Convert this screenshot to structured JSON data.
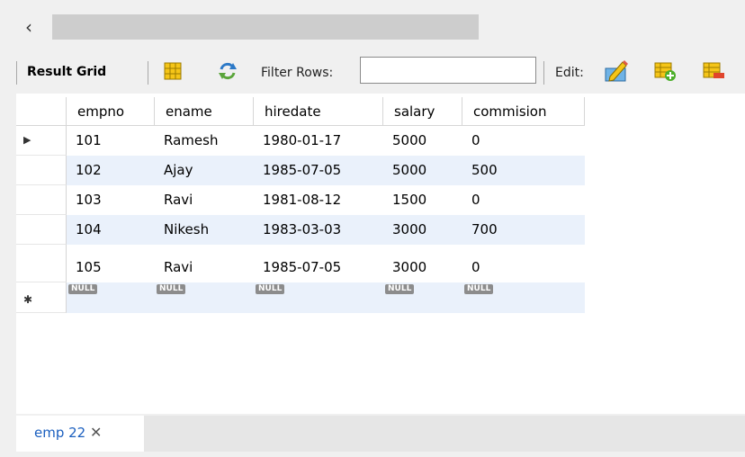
{
  "scroll": {
    "left_arrow": "‹"
  },
  "toolbar": {
    "result_grid": "Result Grid",
    "filter_label": "Filter Rows:",
    "filter_value": "",
    "edit_label": "Edit:"
  },
  "grid": {
    "columns": [
      "empno",
      "ename",
      "hiredate",
      "salary",
      "commision"
    ],
    "rows": [
      [
        "101",
        "Ramesh",
        "1980-01-17",
        "5000",
        "0"
      ],
      [
        "102",
        "Ajay",
        "1985-07-05",
        "5000",
        "500"
      ],
      [
        "103",
        "Ravi",
        "1981-08-12",
        "1500",
        "0"
      ],
      [
        "104",
        "Nikesh",
        "1983-03-03",
        "3000",
        "700"
      ],
      [
        "105",
        "Ravi",
        "1985-07-05",
        "3000",
        "0"
      ]
    ],
    "null_text": "NULL",
    "current_marker": "▶",
    "new_marker": "✱"
  },
  "tab": {
    "label": "emp 22",
    "close": "✕"
  }
}
